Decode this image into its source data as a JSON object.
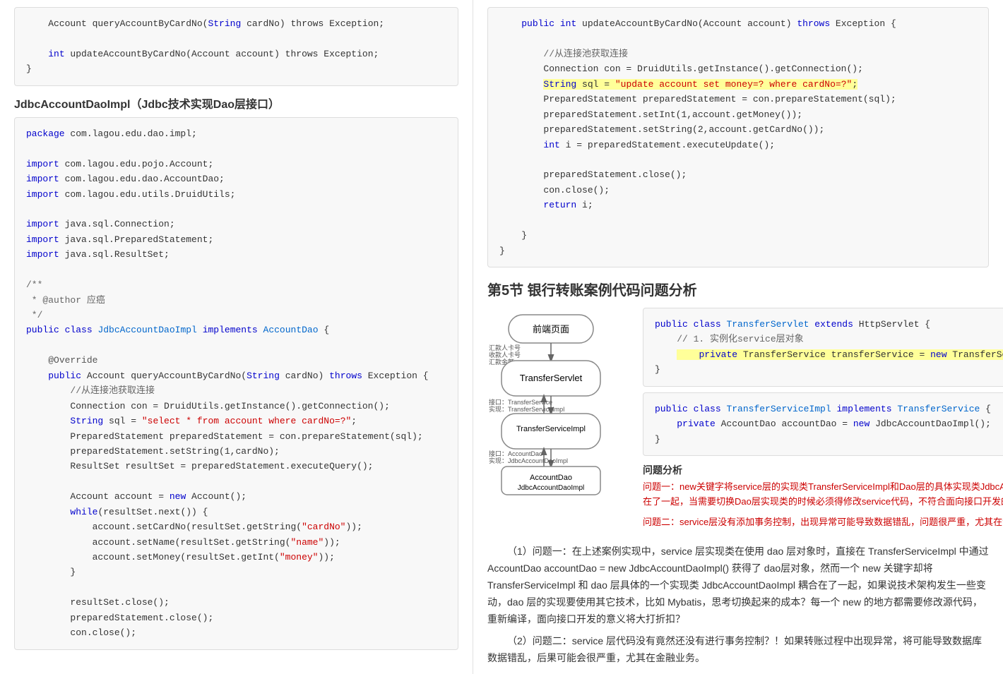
{
  "left": {
    "section_title": "JdbcAccountDaoImpl（Jdbc技术实现Dao层接口）",
    "top_code": {
      "lines": [
        {
          "text": "    Account queryAccountByCardNo(String cardNo) throws Exception;",
          "parts": [
            {
              "text": "    Account queryAccountByCardNo("
            },
            {
              "text": "String",
              "color": "blue"
            },
            {
              "text": " cardNo) throws Exception;"
            }
          ]
        },
        {
          "text": ""
        },
        {
          "text": "    int updateAccountByCardNo(Account account) throws Exception;",
          "parts": [
            {
              "text": "    "
            },
            {
              "text": "int",
              "color": "blue"
            },
            {
              "text": " updateAccountByCardNo(Account account) throws Exception;"
            }
          ]
        },
        {
          "text": "}"
        }
      ]
    },
    "impl_code": {
      "package_line": "package com.lagou.edu.dao.impl;",
      "imports": [
        "import com.lagou.edu.pojo.Account;",
        "import com.lagou.edu.dao.AccountDao;",
        "import com.lagou.edu.utils.DruidUtils;",
        "",
        "import java.sql.Connection;",
        "import java.sql.PreparedStatement;",
        "import java.sql.ResultSet;"
      ],
      "javadoc": [
        "/**",
        " * @author 应癌",
        " */"
      ],
      "class_decl": "public class JdbcAccountDaoImpl implements AccountDao {",
      "methods": []
    }
  },
  "right": {
    "section5_title": "第5节 银行转账案例代码问题分析",
    "problem_analysis_label": "问题分析",
    "problem1_red": "问题一：new关键字将service层的实现类TransferServiceImpl和Dao层的具体实现类JdbcAccountDaoImpl耦合在了一起，当需要切换Dao层实现类的时候必须得修改service代码，不符合面向接口开发的最优原则",
    "problem2_red": "问题二：service层没有添加事务控制，出现异常可能导致数据错乱，问题很严重，尤其在金融银行行业",
    "desc1_title": "（1）问题一：在上述案例实现中，service 层实现类在使用 dao 层对象时，直接在 TransferServiceImpl 中通过 AccountDao accountDao = new JdbcAccountDaoImpl() 获得了 dao层对象，然而一个 new 关键字却将 TransferServiceImpl 和 dao 层具体的一个实现类 JdbcAccountDaoImpl 耦合在了一起，如果说技术架构发生一些变动，dao 层的实现要使用其它技术，比如 Mybatis，思考切换起来的成本？每一个 new 的地方都需要修改源代码，重新编译，面向接口开发的意义将大打折扣？",
    "desc2_title": "（2）问题二：service 层代码没有竟然还没有进行事务控制？！如果转账过程中出现异常，将可能导致数据库数据错乱，后果可能会很严重，尤其在金融业务。"
  }
}
